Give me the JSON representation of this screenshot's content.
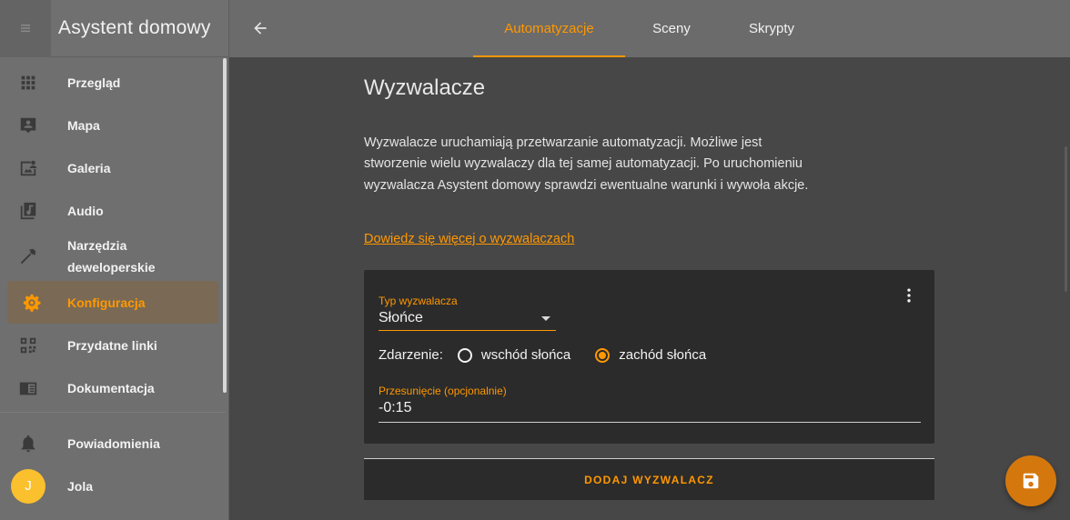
{
  "app": {
    "title": "Asystent domowy"
  },
  "sidebar": {
    "items": [
      {
        "label": "Przegląd",
        "icon": "grid-icon"
      },
      {
        "label": "Mapa",
        "icon": "map-account-icon"
      },
      {
        "label": "Galeria",
        "icon": "image-account-icon"
      },
      {
        "label": "Audio",
        "icon": "music-library-icon"
      },
      {
        "label": "Narzędzia deweloperskie",
        "icon": "hammer-icon"
      },
      {
        "label": "Konfiguracja",
        "icon": "gear-icon",
        "active": true
      },
      {
        "label": "Przydatne linki",
        "icon": "qrcode-icon"
      },
      {
        "label": "Dokumentacja",
        "icon": "book-icon"
      }
    ],
    "notifications_label": "Powiadomienia",
    "user": {
      "initial": "J",
      "name": "Jola"
    }
  },
  "tabs": [
    {
      "label": "Automatyzacje",
      "active": true
    },
    {
      "label": "Sceny",
      "active": false
    },
    {
      "label": "Skrypty",
      "active": false
    }
  ],
  "section": {
    "title": "Wyzwalacze",
    "description": "Wyzwalacze uruchamiają przetwarzanie automatyzacji. Możliwe jest stworzenie wielu wyzwalaczy dla tej samej automatyzacji. Po uruchomieniu wyzwalacza Asystent domowy sprawdzi ewentualne warunki i wywoła akcje.",
    "learn_more": "Dowiedz się więcej o wyzwalaczach"
  },
  "trigger": {
    "type_label": "Typ wyzwalacza",
    "type_value": "Słońce",
    "event_label": "Zdarzenie:",
    "options": [
      {
        "label": "wschód słońca",
        "checked": false
      },
      {
        "label": "zachód słońca",
        "checked": true
      }
    ],
    "offset_label": "Przesunięcie (opcjonalnie)",
    "offset_value": "-0:15"
  },
  "add_trigger_label": "DODAJ WYZWALACZ",
  "colors": {
    "accent": "#ff9800",
    "sidebar_bg": "#6f6f6f",
    "main_bg": "#474747",
    "card_bg": "#2b2b2b",
    "avatar": "#fbc02d",
    "fab": "#d4780d"
  }
}
